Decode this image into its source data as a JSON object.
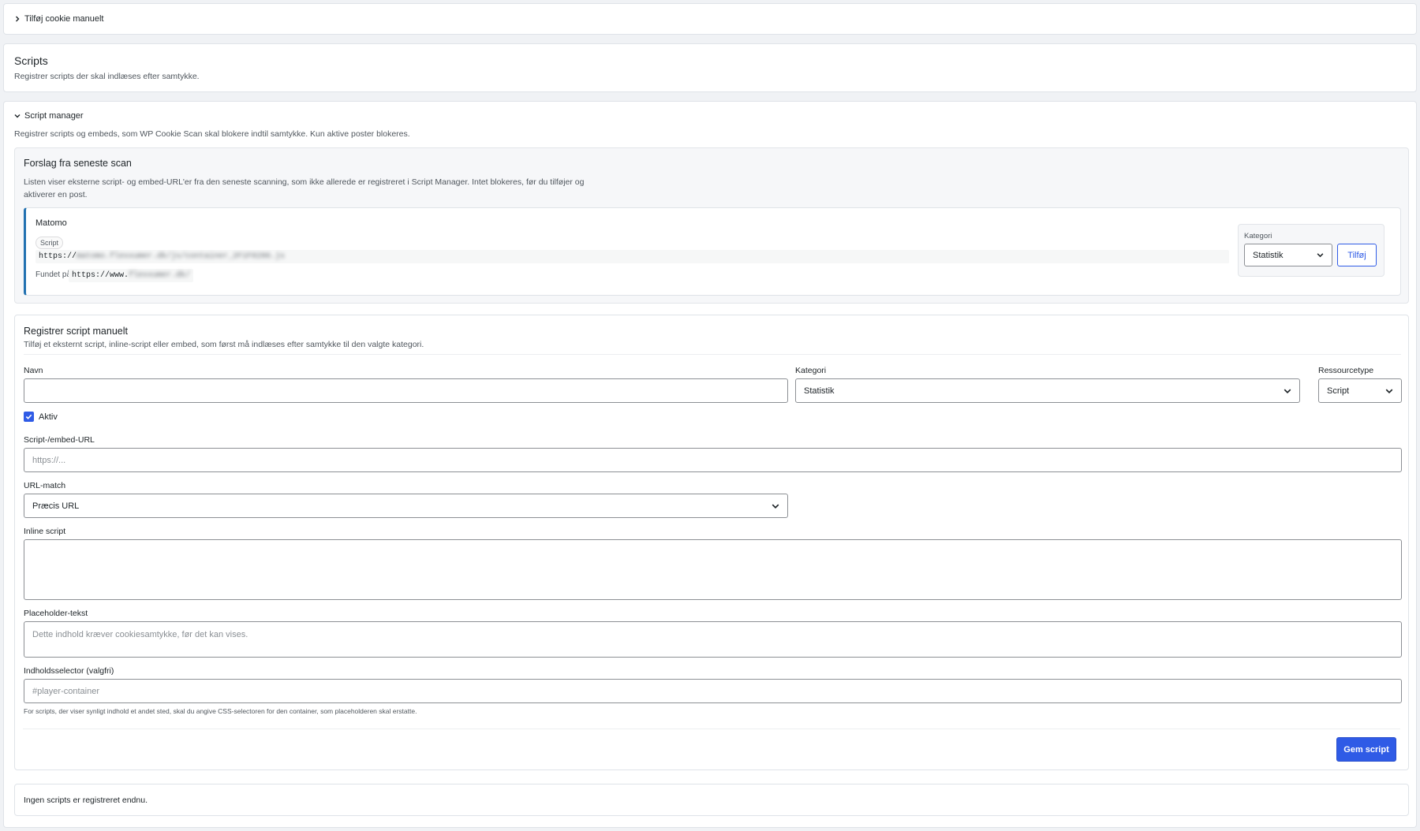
{
  "cookie_section": {
    "toggle_label": "Tilføj cookie manuelt"
  },
  "scripts_section": {
    "title": "Scripts",
    "subtitle": "Registrer scripts der skal indlæses efter samtykke."
  },
  "script_manager": {
    "toggle_label": "Script manager",
    "description": "Registrer scripts og embeds, som WP Cookie Scan skal blokere indtil samtykke. Kun aktive poster blokeres.",
    "suggestions": {
      "title": "Forslag fra seneste scan",
      "description_line1": "Listen viser eksterne script- og embed-URL'er fra den seneste scanning, som ikke allerede er registreret i Script Manager. Intet blokeres, før du tilføjer og",
      "description_line2": "aktiverer en post.",
      "item": {
        "name": "Matomo",
        "badge": "Script",
        "url_prefix": "https://",
        "url_rest": "matomo.flexxumer.dk/js/container_2F1F0286.js",
        "found_label": "Fundet på",
        "found_prefix": "https://www.",
        "found_rest": "flexxumer.dk/",
        "category_label": "Kategori",
        "category_value": "Statistik",
        "add_button": "Tilføj"
      }
    },
    "manual": {
      "title": "Registrer script manuelt",
      "description": "Tilføj et eksternt script, inline-script eller embed, som først må indlæses efter samtykke til den valgte kategori.",
      "name_label": "Navn",
      "name_value": "",
      "category_label": "Kategori",
      "category_value": "Statistik",
      "resource_label": "Ressourcetype",
      "resource_value": "Script",
      "active_label": "Aktiv",
      "url_label": "Script-/embed-URL",
      "url_placeholder": "https://...",
      "match_label": "URL-match",
      "match_value": "Præcis URL",
      "inline_label": "Inline script",
      "placeholder_label": "Placeholder-tekst",
      "placeholder_placeholder": "Dette indhold kræver cookiesamtykke, før det kan vises.",
      "selector_label": "Indholdsselector (valgfri)",
      "selector_placeholder": "#player-container",
      "selector_help": "For scripts, der viser synligt indhold et andet sted, skal du angive CSS-selectoren for den container, som placeholderen skal erstatte.",
      "save_button": "Gem script"
    },
    "empty_state": "Ingen scripts er registreret endnu."
  },
  "colors": {
    "primary": "#2f5be6",
    "accent_border": "#2271b1"
  }
}
